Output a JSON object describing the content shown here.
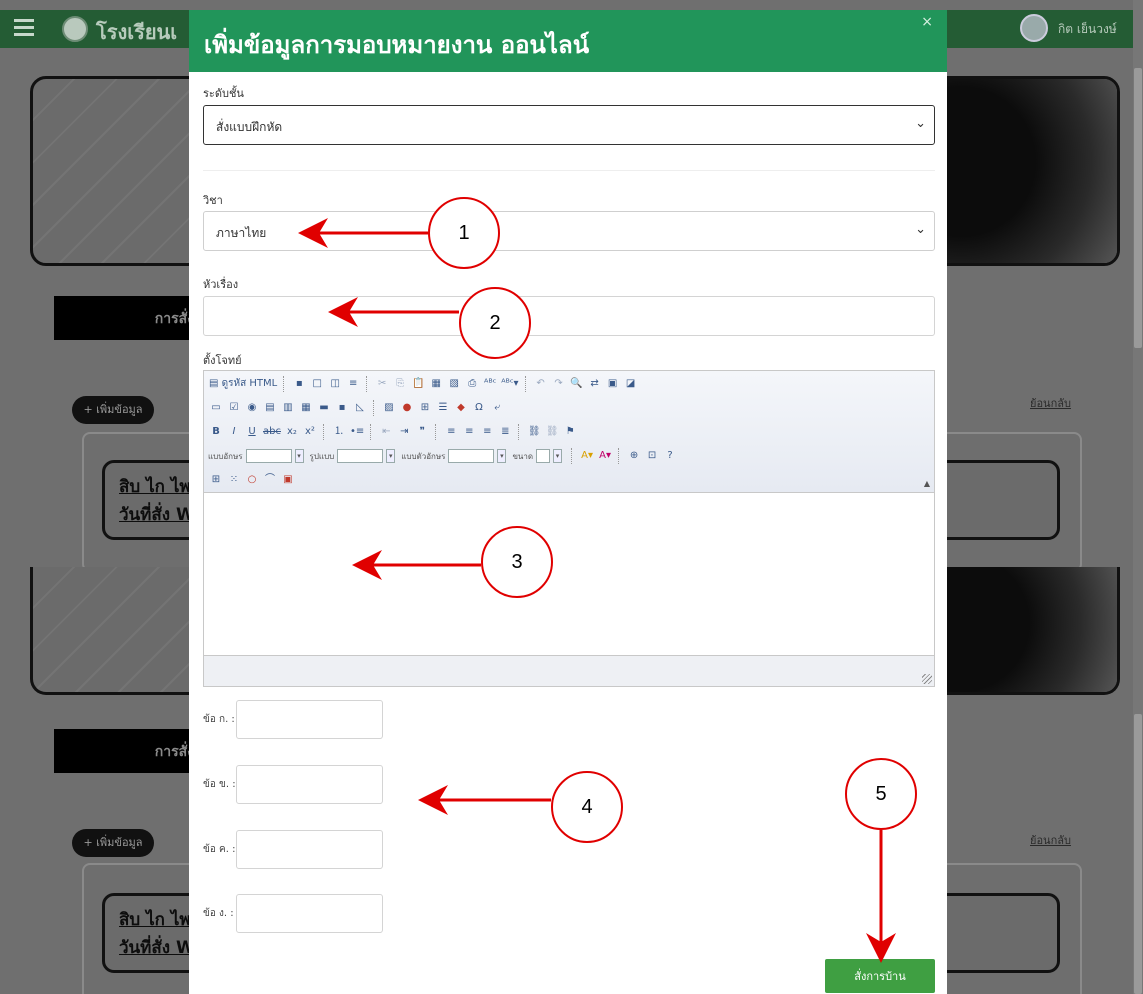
{
  "background_page": {
    "site_name": "โรงเรียนเ",
    "user_name": "กิต เย็นวงษ์",
    "assignment_tab_label": "การสั่ง",
    "add_button_label": "+ เพิ่มข้อมูล",
    "back_link_label": "ย้อนกลับ",
    "cards": [
      {
        "title": "สิบ ไก ไพ",
        "subtitle": "วันที่สั่ง W"
      },
      {
        "title": "สิบ ไก ไพ",
        "subtitle": "วันที่สั่ง W"
      }
    ]
  },
  "modal": {
    "title": "เพิ่มข้อมูลการมอบหมายงาน ออนไลน์",
    "close_label": "×",
    "level_label": "ระดับชั้น",
    "level_value": "สั่งแบบฝึกหัด",
    "subject_label": "วิชา",
    "subject_value": "ภาษาไทย",
    "topic_label": "หัวเรื่อง",
    "topic_value": "",
    "question_label": "ตั้งโจทย์",
    "editor": {
      "source_button": "ดูรหัส HTML",
      "font_label": "แบบอักษร",
      "format_label": "รูปแบบ",
      "style_label": "แบบตัวอักษร",
      "size_label": "ขนาด",
      "content": ""
    },
    "options": [
      {
        "label": "ข้อ ก. :",
        "value": ""
      },
      {
        "label": "ข้อ ข. :",
        "value": ""
      },
      {
        "label": "ข้อ ค. :",
        "value": ""
      },
      {
        "label": "ข้อ ง. :",
        "value": ""
      }
    ],
    "submit_label": "สั่งการบ้าน"
  },
  "annotations": {
    "color": "#e00000",
    "callouts": [
      "1",
      "2",
      "3",
      "4",
      "5"
    ]
  }
}
